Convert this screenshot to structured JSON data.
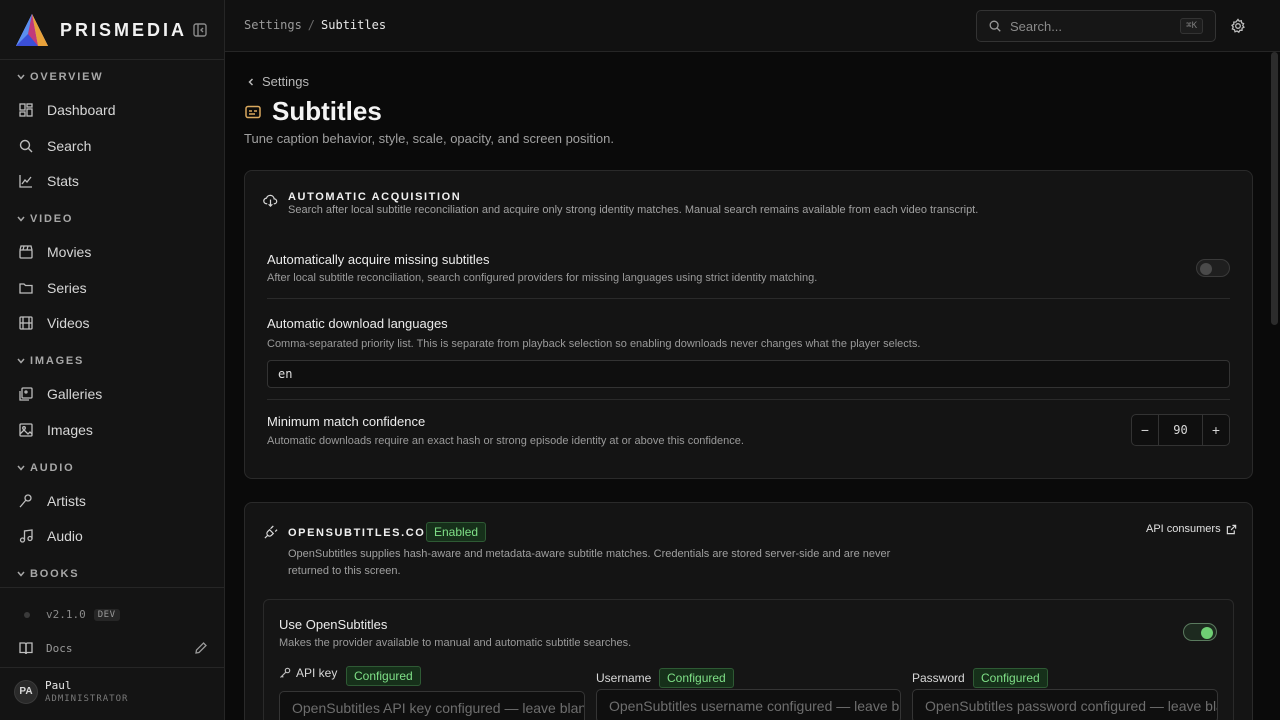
{
  "brand": {
    "name": "PRISMEDIA"
  },
  "sidebar": {
    "sections": [
      {
        "title": "OVERVIEW",
        "items": [
          "Dashboard",
          "Search",
          "Stats"
        ]
      },
      {
        "title": "VIDEO",
        "items": [
          "Movies",
          "Series",
          "Videos"
        ]
      },
      {
        "title": "IMAGES",
        "items": [
          "Galleries",
          "Images"
        ]
      },
      {
        "title": "AUDIO",
        "items": [
          "Artists",
          "Audio"
        ]
      },
      {
        "title": "BOOKS",
        "items": []
      }
    ],
    "version": "v2.1.0",
    "version_tag": "DEV",
    "docs_label": "Docs",
    "user": {
      "initials": "PA",
      "name": "Paul",
      "role": "ADMINISTRATOR"
    }
  },
  "header": {
    "breadcrumb_parent": "Settings",
    "breadcrumb_sep": "/",
    "breadcrumb_current": "Subtitles",
    "search_placeholder": "Search...",
    "search_shortcut": "⌘K"
  },
  "page": {
    "back_label": "Settings",
    "title": "Subtitles",
    "subtitle": "Tune caption behavior, style, scale, opacity, and screen position."
  },
  "acquisition": {
    "heading": "AUTOMATIC ACQUISITION",
    "description": "Search after local subtitle reconciliation and acquire only strong identity matches. Manual search remains available from each video transcript.",
    "auto_acquire": {
      "title": "Automatically acquire missing subtitles",
      "description": "After local subtitle reconciliation, search configured providers for missing languages using strict identity matching.",
      "enabled": false
    },
    "languages": {
      "title": "Automatic download languages",
      "description": "Comma-separated priority list. This is separate from playback selection so enabling downloads never changes what the player selects.",
      "value": "en"
    },
    "confidence": {
      "title": "Minimum match confidence",
      "description": "Automatic downloads require an exact hash or strong episode identity at or above this confidence.",
      "value": "90",
      "minus": "−",
      "plus": "+"
    }
  },
  "opensubtitles": {
    "heading": "OPENSUBTITLES.COM",
    "status": "Enabled",
    "api_link": "API consumers",
    "description": "OpenSubtitles supplies hash-aware and metadata-aware subtitle matches. Credentials are stored server-side and are never returned to this screen.",
    "use": {
      "title": "Use OpenSubtitles",
      "description": "Makes the provider available to manual and automatic subtitle searches.",
      "enabled": true
    },
    "fields": {
      "api_key": {
        "label": "API key",
        "badge": "Configured",
        "placeholder": "OpenSubtitles API key configured — leave blank to keep"
      },
      "username": {
        "label": "Username",
        "badge": "Configured",
        "placeholder": "OpenSubtitles username configured — leave blank to keep"
      },
      "password": {
        "label": "Password",
        "badge": "Configured",
        "placeholder": "OpenSubtitles password configured — leave blank to keep"
      }
    }
  },
  "colors": {
    "accent_green": "#6fcf74",
    "icon_gold": "#d9a85e",
    "background": "#0a0a0a"
  }
}
